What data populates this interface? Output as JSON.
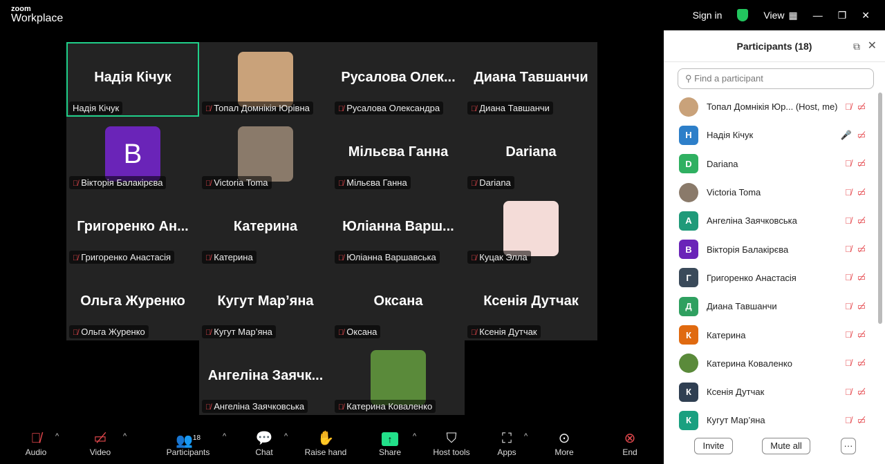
{
  "app": {
    "logo_top": "zoom",
    "logo_bottom": "Workplace",
    "sign_in": "Sign in",
    "view": "View"
  },
  "tiles": [
    {
      "big": "Надія Кічук",
      "label": "Надія Кічук",
      "active": true,
      "muted": false
    },
    {
      "photo": "#c9a27a",
      "label": "Топал Домнікія Юрівна"
    },
    {
      "big": "Русалова Олек...",
      "label": "Русалова Олександра"
    },
    {
      "big": "Диана Тавшанчи",
      "label": "Диана Тавшанчи"
    },
    {
      "avatar": "B",
      "color": "#6a24b8",
      "label": "Вікторія Балакірєва"
    },
    {
      "photo": "#8a7a6a",
      "label": "Victoria Toma"
    },
    {
      "big": "Мільєва Ганна",
      "label": "Мільєва Ганна"
    },
    {
      "big": "Dariana",
      "label": "Dariana"
    },
    {
      "big": "Григоренко Ан...",
      "label": "Григоренко Анастасія"
    },
    {
      "big": "Катерина",
      "label": "Катерина"
    },
    {
      "big": "Юліанна Варш...",
      "label": "Юліанна Варшавська"
    },
    {
      "photo": "#f4dcd8",
      "label": "Куцак Элла"
    },
    {
      "big": "Ольга Журенко",
      "label": "Ольга Журенко"
    },
    {
      "big": "Кугут Мар’яна",
      "label": "Кугут Мар’яна"
    },
    {
      "big": "Оксана",
      "label": "Оксана"
    },
    {
      "big": "Ксенія Дутчак",
      "label": "Ксенія Дутчак"
    },
    {
      "big": "Ангеліна Заячк...",
      "label": "Ангеліна Заячковська"
    },
    {
      "photo": "#5a8a3a",
      "label": "Катерина Коваленко"
    }
  ],
  "toolbar": {
    "audio": "Audio",
    "video": "Video",
    "participants": "Participants",
    "participants_count": "18",
    "chat": "Chat",
    "raise_hand": "Raise hand",
    "share": "Share",
    "host_tools": "Host tools",
    "apps": "Apps",
    "more": "More",
    "end": "End"
  },
  "panel": {
    "title": "Participants (18)",
    "search_placeholder": "Find a participant",
    "invite": "Invite",
    "mute_all": "Mute all",
    "more": "···",
    "participants": [
      {
        "name": "Топал Домнікія Юр... (Host, me)",
        "photo": "#c9a27a"
      },
      {
        "name": "Надія Кічук",
        "initial": "Н",
        "color": "#2d7fc9",
        "unmuted": true
      },
      {
        "name": "Dariana",
        "initial": "D",
        "color": "#2fb061"
      },
      {
        "name": "Victoria Toma",
        "photo": "#8a7a6a"
      },
      {
        "name": "Ангеліна Заячковська",
        "initial": "А",
        "color": "#1f9a79"
      },
      {
        "name": "Вікторія Балакірєва",
        "initial": "В",
        "color": "#6a24b8"
      },
      {
        "name": "Григоренко Анастасія",
        "initial": "Г",
        "color": "#3a4a5a"
      },
      {
        "name": "Диана Тавшанчи",
        "initial": "Д",
        "color": "#2fa060"
      },
      {
        "name": "Катерина",
        "initial": "К",
        "color": "#e06a10"
      },
      {
        "name": "Катерина Коваленко",
        "photo": "#5a8a3a"
      },
      {
        "name": "Ксенія Дутчак",
        "initial": "К",
        "color": "#2f3f52"
      },
      {
        "name": "Кугут Мар’яна",
        "initial": "К",
        "color": "#19a080"
      }
    ]
  }
}
